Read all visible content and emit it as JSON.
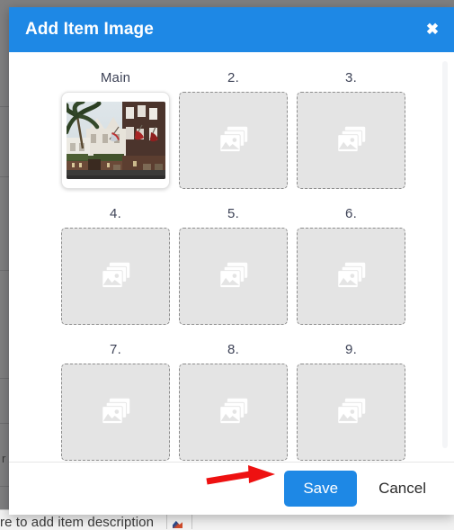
{
  "modal": {
    "title": "Add Item Image",
    "close_icon": "close-icon",
    "header_color": "#1e88e5",
    "slots": [
      {
        "label": "Main",
        "state": "filled",
        "icon": "image-photo",
        "alt": "hotel courtyard with palm trees and flags"
      },
      {
        "label": "2.",
        "state": "empty",
        "icon": "images-stack-icon"
      },
      {
        "label": "3.",
        "state": "empty",
        "icon": "images-stack-icon"
      },
      {
        "label": "4.",
        "state": "empty",
        "icon": "images-stack-icon"
      },
      {
        "label": "5.",
        "state": "empty",
        "icon": "images-stack-icon"
      },
      {
        "label": "6.",
        "state": "empty",
        "icon": "images-stack-icon"
      },
      {
        "label": "7.",
        "state": "empty",
        "icon": "images-stack-icon"
      },
      {
        "label": "8.",
        "state": "empty",
        "icon": "images-stack-icon"
      },
      {
        "label": "9.",
        "state": "empty",
        "icon": "images-stack-icon"
      }
    ],
    "footer": {
      "save_label": "Save",
      "cancel_label": "Cancel",
      "save_color": "#1e88e5"
    }
  },
  "annotation": {
    "arrow_color": "#ee1111",
    "points_to": "Save"
  },
  "background": {
    "bottom_text": "re to add item description",
    "left_letter": "r",
    "page_color": "#808080"
  }
}
